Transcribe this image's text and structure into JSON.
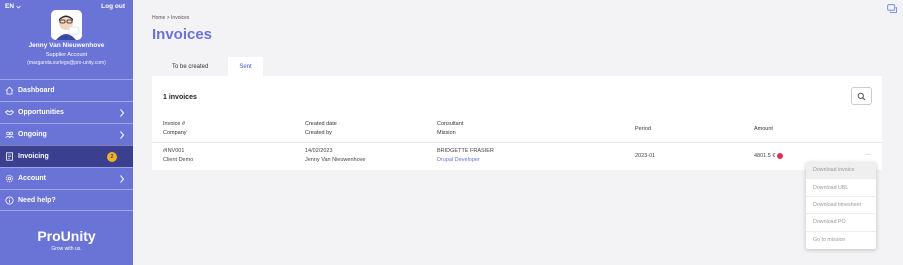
{
  "sidebar": {
    "language": "EN",
    "logout_label": "Log out",
    "user_name": "Jenny Van Nieuwenhove",
    "user_role": "Supplier Account",
    "user_email": "(margarota.surlegs@pro-unity.com)",
    "nav": [
      {
        "label": "Dashboard",
        "icon": "home-icon"
      },
      {
        "label": "Opportunities",
        "icon": "handshake-icon"
      },
      {
        "label": "Ongoing",
        "icon": "people-icon"
      },
      {
        "label": "Invoicing",
        "icon": "document-icon",
        "badge": "2",
        "active": true
      },
      {
        "label": "Account",
        "icon": "gear-icon"
      },
      {
        "label": "Need help?",
        "icon": "info-icon"
      }
    ],
    "brand": "ProUnity",
    "tagline": "Grow with us."
  },
  "page": {
    "breadcrumb": "Home > Invoices",
    "title": "Invoices",
    "tabs": [
      "To be created",
      "Sent"
    ],
    "active_tab": "Sent"
  },
  "table": {
    "count": "1 invoices",
    "headers": {
      "invoice": "Invoice #",
      "company": "Company",
      "created_date": "Created date",
      "created_by": "Created by",
      "consultant": "Consultant",
      "mission": "Mission",
      "period": "Period",
      "amount": "Amount"
    },
    "rows": [
      {
        "invoice": "#INV001",
        "company": "Client Demo",
        "created_date": "14/02/2023",
        "created_by": "Jenny Van Nieuwenhove",
        "consultant": "BRIDGETTE FRASIER",
        "mission": "Drupal Developer",
        "period": "2023-01",
        "amount": "4801.5 €",
        "more": "..."
      }
    ]
  },
  "dropdown": {
    "items": [
      "Download invoice",
      "Download UBL",
      "Download timesheet",
      "Download PO",
      "Go to mission"
    ]
  },
  "colors": {
    "sidebar": "#6a73d6",
    "active_nav": "#3a3f8f",
    "badge": "#f2b31c",
    "status_dot": "#e0304a"
  }
}
